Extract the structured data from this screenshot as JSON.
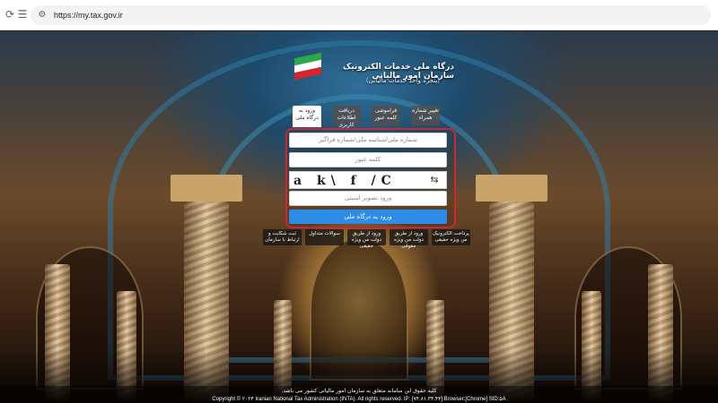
{
  "browser": {
    "url": "https://my.tax.gov.ir",
    "icons": {
      "back": "back-arrow-icon",
      "forward": "forward-arrow-icon",
      "reload": "reload-icon",
      "site_info": "site-info-icon"
    }
  },
  "header": {
    "title": "درگاه ملی خدمات الکترونیک سازمان امور مالیاتی",
    "subtitle": "(پنجره واحد خدمات مالیاتی)",
    "logo": "iran-flag-logo"
  },
  "tabs": [
    {
      "label": "تغییر شماره همراه"
    },
    {
      "label": "فراموشی کلمه عبور"
    },
    {
      "label": "دریافت اطلاعات کاربری"
    },
    {
      "label": "ورود به درگاه ملی"
    }
  ],
  "login": {
    "username_placeholder": "شماره ملی/شناسه ملی/شماره فراگیر",
    "password_placeholder": "کلمه عبور",
    "captcha_text": "a k\\ f /C",
    "captcha_placeholder": "ورود تصویر امنیتی",
    "submit_label": "ورود به درگاه ملی"
  },
  "help_links": [
    {
      "label": "پرداخت الکترونیک من ویژه حقیقی"
    },
    {
      "label": "ورود از طریق دولت من ویژه حقوقی"
    },
    {
      "label": "ورود از طریق دولت من ویژه حقیقی"
    },
    {
      "label": "سوالات متداول"
    },
    {
      "label": "ثبت شکایت و ارتباط با سازمان"
    }
  ],
  "footer": {
    "rights": "کلیه حقوق این سامانه متعلق به سازمان امور مالیاتی کشور می باشد.",
    "copyright": "Copyright © ۲۰۲۴ Iranian National Tax Administration (INTA). All rights reserved. IP: [۷۴.۸۱.۳۴.۴۳] Browser:[Chrome] SID:۵A"
  },
  "colors": {
    "accent_red": "#d0262c",
    "button_blue": "#2d8ce8"
  }
}
